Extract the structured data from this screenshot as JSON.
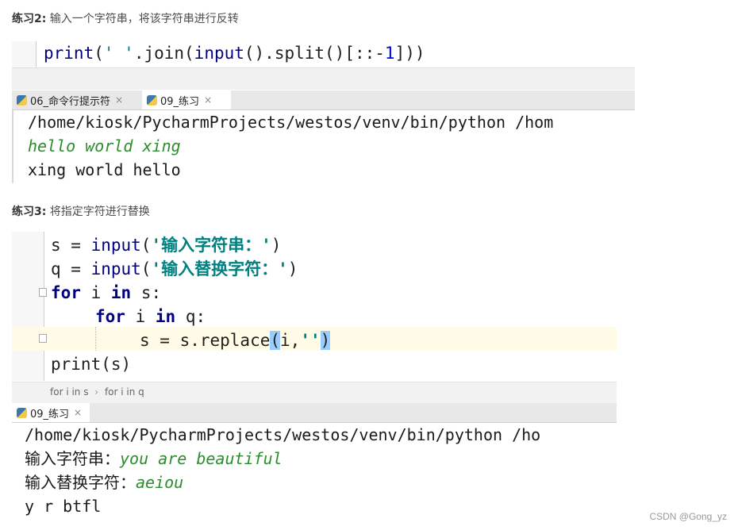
{
  "exercise2": {
    "title_bold": "练习2:",
    "title_text": "输入一个字符串，将该字符串进行反转",
    "code": {
      "fn_print": "print",
      "paren_open": "(",
      "string": "' '",
      "join": ".join(",
      "fn_input": "input",
      "rest": "().split()[::-",
      "number": "1",
      "end": "]))"
    },
    "tabs": [
      {
        "label": "06_命令行提示符",
        "close": "×"
      },
      {
        "label": "09_练习",
        "close": "×"
      }
    ],
    "console": {
      "line1": "/home/kiosk/PycharmProjects/westos/venv/bin/python /hom",
      "line2": "hello world xing",
      "line3": "xing world hello"
    }
  },
  "exercise3": {
    "title_bold": "练习3:",
    "title_text": "将指定字符进行替换",
    "code": {
      "l1_var": "s = ",
      "l1_fn": "input",
      "l1_str": "'输入字符串：'",
      "l2_var": "q = ",
      "l2_fn": "input",
      "l2_str": "'输入替换字符：'",
      "l3_kw1": "for",
      "l3_mid": " i ",
      "l3_kw2": "in",
      "l3_end": " s:",
      "l4_kw1": "for",
      "l4_mid": " i ",
      "l4_kw2": "in",
      "l4_end": " q:",
      "l5_pre": "s = s.replace",
      "l5_open": "(",
      "l5_mid": "i,",
      "l5_str": "''",
      "l5_close": ")",
      "l6": "print(s)"
    },
    "breadcrumb": {
      "item1": "for i in s",
      "sep": "›",
      "item2": "for i in q"
    },
    "tab": {
      "label": "09_练习",
      "close": "×"
    },
    "console": {
      "line1": "/home/kiosk/PycharmProjects/westos/venv/bin/python /ho",
      "line2_prompt": "输入字符串：",
      "line2_input": "you are beautiful",
      "line3_prompt": "输入替换字符：",
      "line3_input": "aeiou",
      "line4": "y r btfl"
    }
  },
  "watermark": "CSDN @Gong_yz"
}
